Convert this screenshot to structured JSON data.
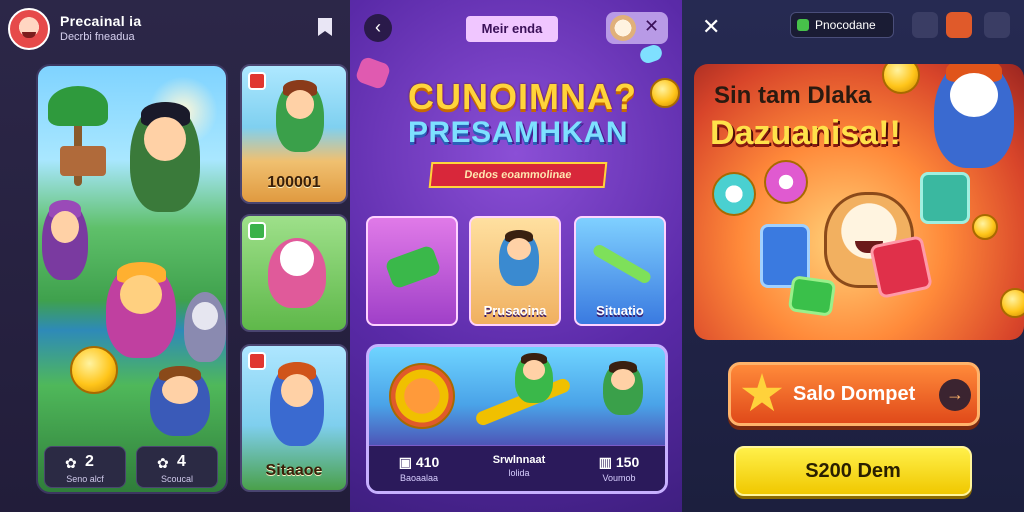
{
  "left_panel": {
    "title": "Precainal ia",
    "subtitle": "Decrbi fneadua",
    "stats": [
      {
        "icon": "✿",
        "value": "2",
        "label": "Seno alcf"
      },
      {
        "icon": "✿",
        "value": "4",
        "label": "Scoucal"
      }
    ],
    "tiles": [
      {
        "caption": "100001"
      },
      {
        "caption": ""
      },
      {
        "caption": "Sitaaoe"
      }
    ]
  },
  "middle_panel": {
    "pill_label": "Meir enda",
    "logo_line1": "CUNOIMNA?",
    "logo_line2": "PRESAMHKAN",
    "ribbon": "Dedos eoammolinae",
    "cards": [
      {
        "label": ""
      },
      {
        "label": "Prusaoina"
      },
      {
        "label": "Situatio"
      }
    ],
    "banner_stats": [
      {
        "value": "▣ 410",
        "label": "Baoaalaa"
      },
      {
        "value": "Srwlnnaat",
        "label": "lolida"
      },
      {
        "value": "▥ 150",
        "label": "Voumob"
      }
    ]
  },
  "right_panel": {
    "chip_label": "Pnocodane",
    "headline1": "Sin tam Dlaka",
    "headline2": "Dazuanisa!!",
    "cta_primary": "Salo Dompet",
    "cta_secondary": "S200 Dem"
  }
}
